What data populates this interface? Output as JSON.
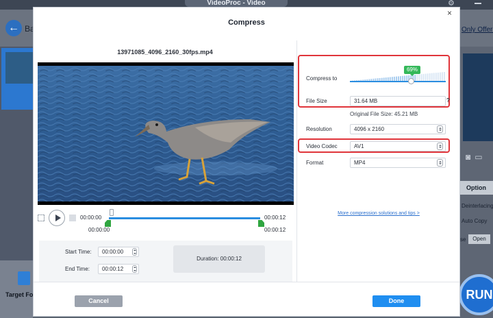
{
  "app": {
    "window_title": "VideoProc - Video",
    "back_label": "Ba",
    "offer_link": "Only Offer >",
    "target_format_label": "Target For",
    "option_label": "Option",
    "deinterlacing_label": "Deinterlacing",
    "auto_copy_label": "Auto Copy",
    "use_label": "se",
    "open_label": "Open",
    "run_label": "RUN"
  },
  "dialog": {
    "title": "Compress",
    "close_symbol": "×",
    "file_name": "13971085_4096_2160_30fps.mp4",
    "playback": {
      "current_time": "00:00:00",
      "end_time": "00:00:12",
      "start_marker": "00:00:00",
      "end_marker": "00:00:12"
    },
    "trim": {
      "start_label": "Start Time:",
      "start_value": "00:00:00",
      "end_label": "End Time:",
      "end_value": "00:00:12",
      "duration_label": "Duration:",
      "duration_value": "00:00:12"
    },
    "settings": {
      "compress_label": "Compress to",
      "compress_percent": "69%",
      "compress_fraction": 0.69,
      "file_size_label": "File Size",
      "file_size_value": "31.64  MB",
      "help": "?",
      "original_size": "Original File Size: 45.21 MB",
      "resolution_label": "Resolution",
      "resolution_value": "4096 x 2160",
      "codec_label": "Video Codec",
      "codec_value": "AV1",
      "format_label": "Format",
      "format_value": "MP4",
      "more_link": "More compression solutions and tips >"
    },
    "buttons": {
      "cancel": "Cancel",
      "done": "Done"
    }
  },
  "colors": {
    "accent": "#1f8ef0",
    "highlight": "#e0343a",
    "tooltip": "#34b85a",
    "handle": "#2fa540"
  }
}
